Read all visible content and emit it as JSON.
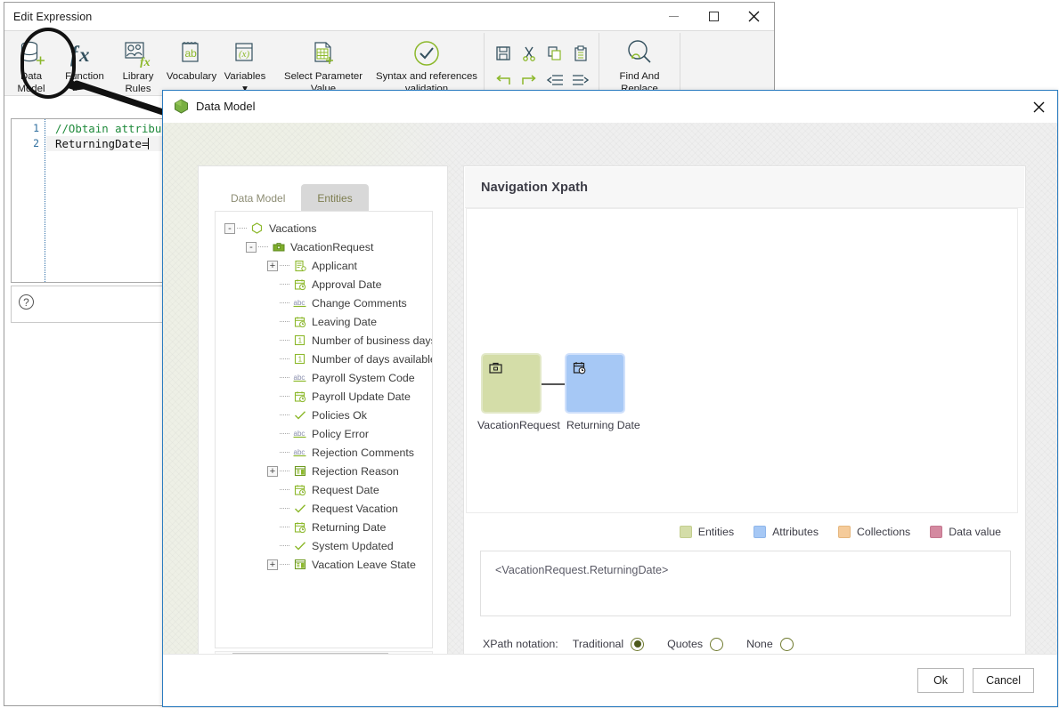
{
  "base_window": {
    "title": "Edit Expression",
    "window_controls": {
      "minimize": "minimize-icon",
      "maximize": "maximize-icon",
      "close": "✕"
    },
    "ribbon": {
      "items": [
        {
          "label_line1": "Data",
          "label_line2": "Model",
          "icon": "database-add-icon",
          "highlighted": true
        },
        {
          "label_line1": "Function",
          "label_line2": "",
          "icon": "fx-icon"
        },
        {
          "label_line1": "Library",
          "label_line2": "Rules",
          "icon": "library-rules-icon"
        },
        {
          "label_line1": "Vocabulary",
          "label_line2": "",
          "icon": "vocabulary-ab-icon"
        },
        {
          "label_line1": "Variables",
          "label_line2": "▾",
          "icon": "variables-x-icon"
        },
        {
          "label_line1": "Select Parameter",
          "label_line2": "Value",
          "icon": "select-parameter-icon"
        },
        {
          "label_line1": "Syntax and references",
          "label_line2": "validation",
          "icon": "check-circle-icon"
        }
      ],
      "small_icons": [
        "save-icon",
        "cut-icon",
        "copy-icon",
        "paste-icon",
        "undo-icon",
        "redo-icon",
        "outdent-icon",
        "indent-icon"
      ],
      "find_replace": {
        "label_line1": "Find And",
        "label_line2": "Replace",
        "icon": "find-replace-icon"
      }
    },
    "editor": {
      "lines": [
        {
          "number": "1",
          "text": "//Obtain attribute",
          "kind": "comment"
        },
        {
          "number": "2",
          "text": "ReturningDate=",
          "kind": "code"
        }
      ]
    },
    "status_pane": {
      "help_icon": "help-question-icon",
      "help_glyph": "?"
    }
  },
  "dialog": {
    "title": "Data Model",
    "icon": "data-model-cube-icon",
    "close_glyph": "✕",
    "tabs": [
      {
        "label": "Data Model",
        "active": true
      },
      {
        "label": "Entities",
        "active": false
      }
    ],
    "tree": [
      {
        "label": "Vacations",
        "indent": 0,
        "expander": "-",
        "icon": "hexagon-icon"
      },
      {
        "label": "VacationRequest",
        "indent": 1,
        "expander": "-",
        "icon": "briefcase-icon"
      },
      {
        "label": "Applicant",
        "indent": 2,
        "expander": "+",
        "icon": "entity-ref-icon"
      },
      {
        "label": "Approval Date",
        "indent": 2,
        "expander": "",
        "icon": "date-icon"
      },
      {
        "label": "Change Comments",
        "indent": 2,
        "expander": "",
        "icon": "abc-icon"
      },
      {
        "label": "Leaving Date",
        "indent": 2,
        "expander": "",
        "icon": "date-icon"
      },
      {
        "label": "Number of business days",
        "indent": 2,
        "expander": "",
        "icon": "number-icon"
      },
      {
        "label": "Number of days available",
        "indent": 2,
        "expander": "",
        "icon": "number-icon"
      },
      {
        "label": "Payroll System Code",
        "indent": 2,
        "expander": "",
        "icon": "abc-icon"
      },
      {
        "label": "Payroll Update Date",
        "indent": 2,
        "expander": "",
        "icon": "date-icon"
      },
      {
        "label": "Policies Ok",
        "indent": 2,
        "expander": "",
        "icon": "boolean-check-icon"
      },
      {
        "label": "Policy Error",
        "indent": 2,
        "expander": "",
        "icon": "abc-icon"
      },
      {
        "label": "Rejection Comments",
        "indent": 2,
        "expander": "",
        "icon": "abc-icon"
      },
      {
        "label": "Rejection Reason",
        "indent": 2,
        "expander": "+",
        "icon": "collection-icon"
      },
      {
        "label": "Request Date",
        "indent": 2,
        "expander": "",
        "icon": "date-icon"
      },
      {
        "label": "Request Vacation",
        "indent": 2,
        "expander": "",
        "icon": "boolean-check-icon"
      },
      {
        "label": "Returning Date",
        "indent": 2,
        "expander": "",
        "icon": "date-icon"
      },
      {
        "label": "System Updated",
        "indent": 2,
        "expander": "",
        "icon": "boolean-check-icon"
      },
      {
        "label": "Vacation Leave State",
        "indent": 2,
        "expander": "+",
        "icon": "collection-icon"
      }
    ],
    "navigation": {
      "title": "Navigation Xpath",
      "nodes": [
        {
          "label": "VacationRequest",
          "type": "entity",
          "icon": "briefcase-icon",
          "color": "#d4dda8"
        },
        {
          "label": "Returning Date",
          "type": "attribute",
          "icon": "date-icon",
          "color": "#a6c8f5"
        }
      ],
      "legend": [
        {
          "label": "Entities",
          "color": "#d4dda8"
        },
        {
          "label": "Attributes",
          "color": "#a6c8f5"
        },
        {
          "label": "Collections",
          "color": "#f5cb9a"
        },
        {
          "label": "Data value",
          "color": "#d489a0"
        }
      ],
      "xpath_expression": "<VacationRequest.ReturningDate>",
      "notation_label": "XPath notation:",
      "notation_options": [
        {
          "label": "Traditional",
          "selected": true
        },
        {
          "label": "Quotes",
          "selected": false
        },
        {
          "label": "None",
          "selected": false
        }
      ]
    },
    "footer": {
      "ok_label": "Ok",
      "cancel_label": "Cancel"
    },
    "scrollbar": {
      "left_arrow": "◀",
      "right_arrow": "▶"
    }
  }
}
